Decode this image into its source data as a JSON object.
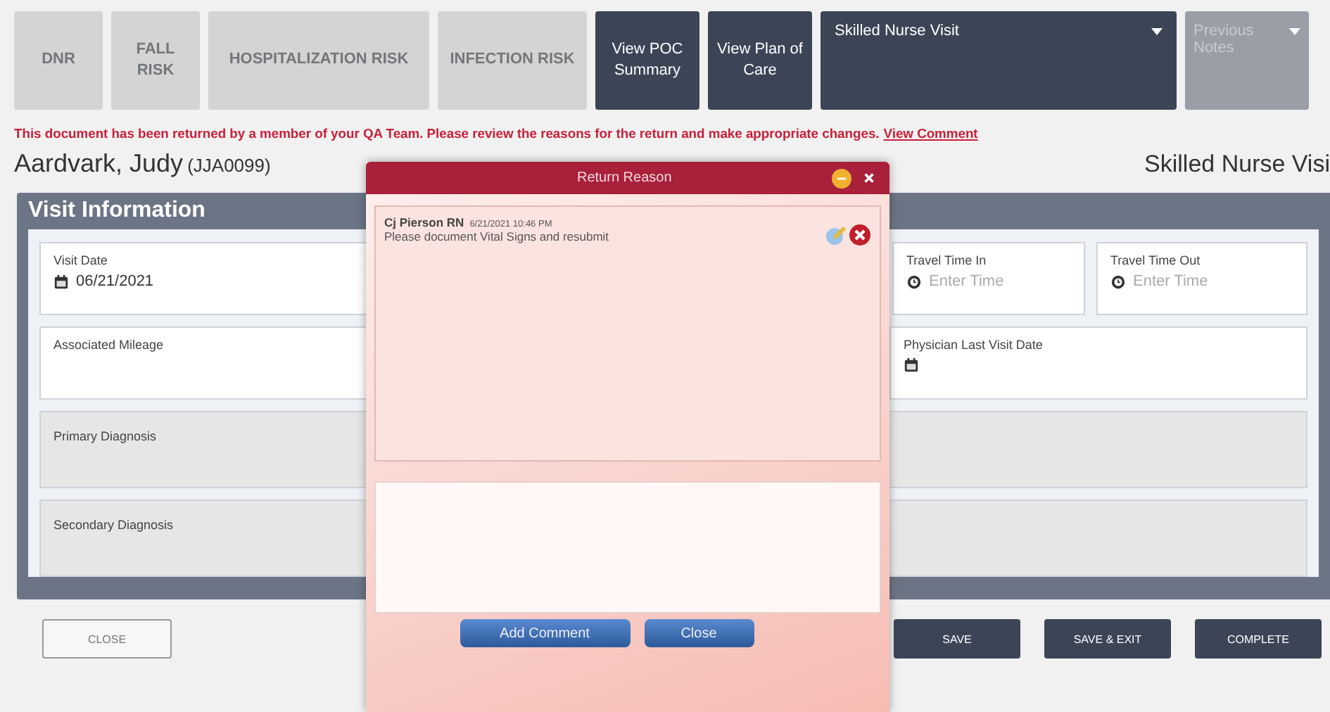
{
  "toolbar": [
    {
      "label": "DNR",
      "kind": "tile",
      "disabled": true
    },
    {
      "label": "FALL RISK",
      "kind": "tile",
      "disabled": true
    },
    {
      "label": "HOSPITALIZATION RISK",
      "kind": "tile",
      "disabled": true
    },
    {
      "label": "INFECTION RISK",
      "kind": "tile",
      "disabled": true
    },
    {
      "label": "View POC Summary",
      "kind": "tile",
      "disabled": false
    },
    {
      "label": "View Plan of Care",
      "kind": "tile",
      "disabled": false
    },
    {
      "label": "Skilled Nurse Visit",
      "kind": "dropdown",
      "disabled": false
    },
    {
      "label": "Previous Notes",
      "kind": "dropdown",
      "disabled": true
    }
  ],
  "alert": {
    "message": "This document has been returned by a member of your QA Team. Please review the reasons for the return and make appropriate changes.",
    "link": "View Comment"
  },
  "patient": {
    "name": "Aardvark, Judy",
    "id": "(JJA0099)"
  },
  "visit_type": "Skilled Nurse Visi",
  "section": {
    "title": "Visit Information",
    "rows": [
      [
        {
          "label": "Visit Date",
          "kind": "date",
          "value": "06/21/2021",
          "disabled": false
        },
        {
          "label": "Travel Time In",
          "kind": "time",
          "placeholder": "Enter Time",
          "disabled": false
        },
        {
          "label": "Travel Time Out",
          "kind": "time",
          "placeholder": "Enter Time",
          "disabled": false
        }
      ],
      [
        {
          "label": "Associated Mileage",
          "kind": "text",
          "disabled": false
        },
        {
          "label": "Physician Last Visit Date",
          "kind": "date",
          "disabled": false
        }
      ],
      [
        {
          "label": "Primary Diagnosis",
          "kind": "text",
          "disabled": true
        }
      ],
      [
        {
          "label": "Secondary Diagnosis",
          "kind": "text",
          "disabled": true
        }
      ]
    ]
  },
  "footer_buttons": [
    {
      "label": "CLOSE",
      "kind": "light"
    },
    {
      "label": "SAVE",
      "kind": "dark"
    },
    {
      "label": "SAVE & EXIT",
      "kind": "dark"
    },
    {
      "label": "COMPLETE",
      "kind": "dark"
    }
  ],
  "dialog": {
    "title": "Return Reason",
    "comments": [
      {
        "author": "Cj Pierson RN",
        "time": "6/21/2021 10:46 PM",
        "text": "Please document Vital Signs and resubmit"
      }
    ],
    "buttons": [
      "Add Comment",
      "Close"
    ]
  }
}
